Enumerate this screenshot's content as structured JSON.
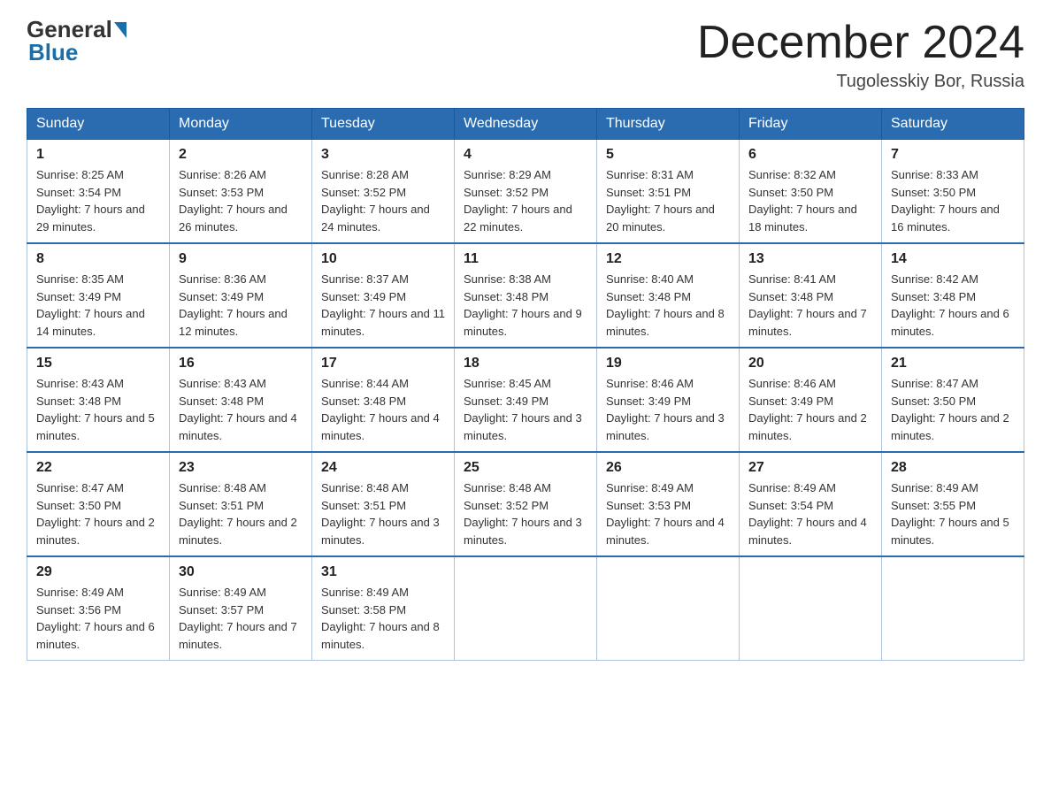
{
  "header": {
    "logo_general": "General",
    "logo_blue": "Blue",
    "month_title": "December 2024",
    "location": "Tugolesskiy Bor, Russia"
  },
  "days_of_week": [
    "Sunday",
    "Monday",
    "Tuesday",
    "Wednesday",
    "Thursday",
    "Friday",
    "Saturday"
  ],
  "weeks": [
    [
      {
        "day": "1",
        "sunrise": "8:25 AM",
        "sunset": "3:54 PM",
        "daylight": "7 hours and 29 minutes."
      },
      {
        "day": "2",
        "sunrise": "8:26 AM",
        "sunset": "3:53 PM",
        "daylight": "7 hours and 26 minutes."
      },
      {
        "day": "3",
        "sunrise": "8:28 AM",
        "sunset": "3:52 PM",
        "daylight": "7 hours and 24 minutes."
      },
      {
        "day": "4",
        "sunrise": "8:29 AM",
        "sunset": "3:52 PM",
        "daylight": "7 hours and 22 minutes."
      },
      {
        "day": "5",
        "sunrise": "8:31 AM",
        "sunset": "3:51 PM",
        "daylight": "7 hours and 20 minutes."
      },
      {
        "day": "6",
        "sunrise": "8:32 AM",
        "sunset": "3:50 PM",
        "daylight": "7 hours and 18 minutes."
      },
      {
        "day": "7",
        "sunrise": "8:33 AM",
        "sunset": "3:50 PM",
        "daylight": "7 hours and 16 minutes."
      }
    ],
    [
      {
        "day": "8",
        "sunrise": "8:35 AM",
        "sunset": "3:49 PM",
        "daylight": "7 hours and 14 minutes."
      },
      {
        "day": "9",
        "sunrise": "8:36 AM",
        "sunset": "3:49 PM",
        "daylight": "7 hours and 12 minutes."
      },
      {
        "day": "10",
        "sunrise": "8:37 AM",
        "sunset": "3:49 PM",
        "daylight": "7 hours and 11 minutes."
      },
      {
        "day": "11",
        "sunrise": "8:38 AM",
        "sunset": "3:48 PM",
        "daylight": "7 hours and 9 minutes."
      },
      {
        "day": "12",
        "sunrise": "8:40 AM",
        "sunset": "3:48 PM",
        "daylight": "7 hours and 8 minutes."
      },
      {
        "day": "13",
        "sunrise": "8:41 AM",
        "sunset": "3:48 PM",
        "daylight": "7 hours and 7 minutes."
      },
      {
        "day": "14",
        "sunrise": "8:42 AM",
        "sunset": "3:48 PM",
        "daylight": "7 hours and 6 minutes."
      }
    ],
    [
      {
        "day": "15",
        "sunrise": "8:43 AM",
        "sunset": "3:48 PM",
        "daylight": "7 hours and 5 minutes."
      },
      {
        "day": "16",
        "sunrise": "8:43 AM",
        "sunset": "3:48 PM",
        "daylight": "7 hours and 4 minutes."
      },
      {
        "day": "17",
        "sunrise": "8:44 AM",
        "sunset": "3:48 PM",
        "daylight": "7 hours and 4 minutes."
      },
      {
        "day": "18",
        "sunrise": "8:45 AM",
        "sunset": "3:49 PM",
        "daylight": "7 hours and 3 minutes."
      },
      {
        "day": "19",
        "sunrise": "8:46 AM",
        "sunset": "3:49 PM",
        "daylight": "7 hours and 3 minutes."
      },
      {
        "day": "20",
        "sunrise": "8:46 AM",
        "sunset": "3:49 PM",
        "daylight": "7 hours and 2 minutes."
      },
      {
        "day": "21",
        "sunrise": "8:47 AM",
        "sunset": "3:50 PM",
        "daylight": "7 hours and 2 minutes."
      }
    ],
    [
      {
        "day": "22",
        "sunrise": "8:47 AM",
        "sunset": "3:50 PM",
        "daylight": "7 hours and 2 minutes."
      },
      {
        "day": "23",
        "sunrise": "8:48 AM",
        "sunset": "3:51 PM",
        "daylight": "7 hours and 2 minutes."
      },
      {
        "day": "24",
        "sunrise": "8:48 AM",
        "sunset": "3:51 PM",
        "daylight": "7 hours and 3 minutes."
      },
      {
        "day": "25",
        "sunrise": "8:48 AM",
        "sunset": "3:52 PM",
        "daylight": "7 hours and 3 minutes."
      },
      {
        "day": "26",
        "sunrise": "8:49 AM",
        "sunset": "3:53 PM",
        "daylight": "7 hours and 4 minutes."
      },
      {
        "day": "27",
        "sunrise": "8:49 AM",
        "sunset": "3:54 PM",
        "daylight": "7 hours and 4 minutes."
      },
      {
        "day": "28",
        "sunrise": "8:49 AM",
        "sunset": "3:55 PM",
        "daylight": "7 hours and 5 minutes."
      }
    ],
    [
      {
        "day": "29",
        "sunrise": "8:49 AM",
        "sunset": "3:56 PM",
        "daylight": "7 hours and 6 minutes."
      },
      {
        "day": "30",
        "sunrise": "8:49 AM",
        "sunset": "3:57 PM",
        "daylight": "7 hours and 7 minutes."
      },
      {
        "day": "31",
        "sunrise": "8:49 AM",
        "sunset": "3:58 PM",
        "daylight": "7 hours and 8 minutes."
      },
      null,
      null,
      null,
      null
    ]
  ]
}
